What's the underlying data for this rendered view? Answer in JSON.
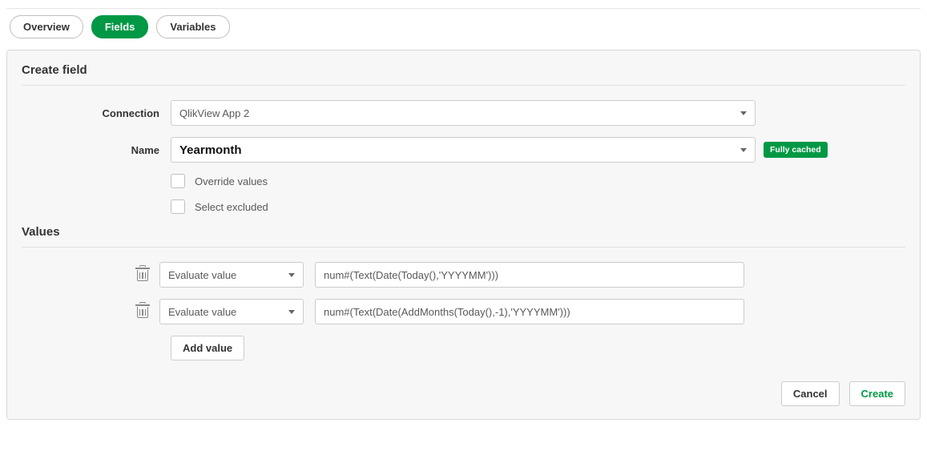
{
  "tabs": {
    "overview": "Overview",
    "fields": "Fields",
    "variables": "Variables"
  },
  "panel": {
    "title": "Create field",
    "connection_label": "Connection",
    "connection_value": "QlikView App 2",
    "name_label": "Name",
    "name_value": "Yearmonth",
    "badge": "Fully cached",
    "override_label": "Override values",
    "excluded_label": "Select excluded"
  },
  "values": {
    "title": "Values",
    "rows": [
      {
        "mode": "Evaluate value",
        "expr": "num#(Text(Date(Today(),'YYYYMM')))"
      },
      {
        "mode": "Evaluate value",
        "expr": "num#(Text(Date(AddMonths(Today(),-1),'YYYYMM')))"
      }
    ],
    "add_label": "Add value"
  },
  "footer": {
    "cancel": "Cancel",
    "create": "Create"
  }
}
